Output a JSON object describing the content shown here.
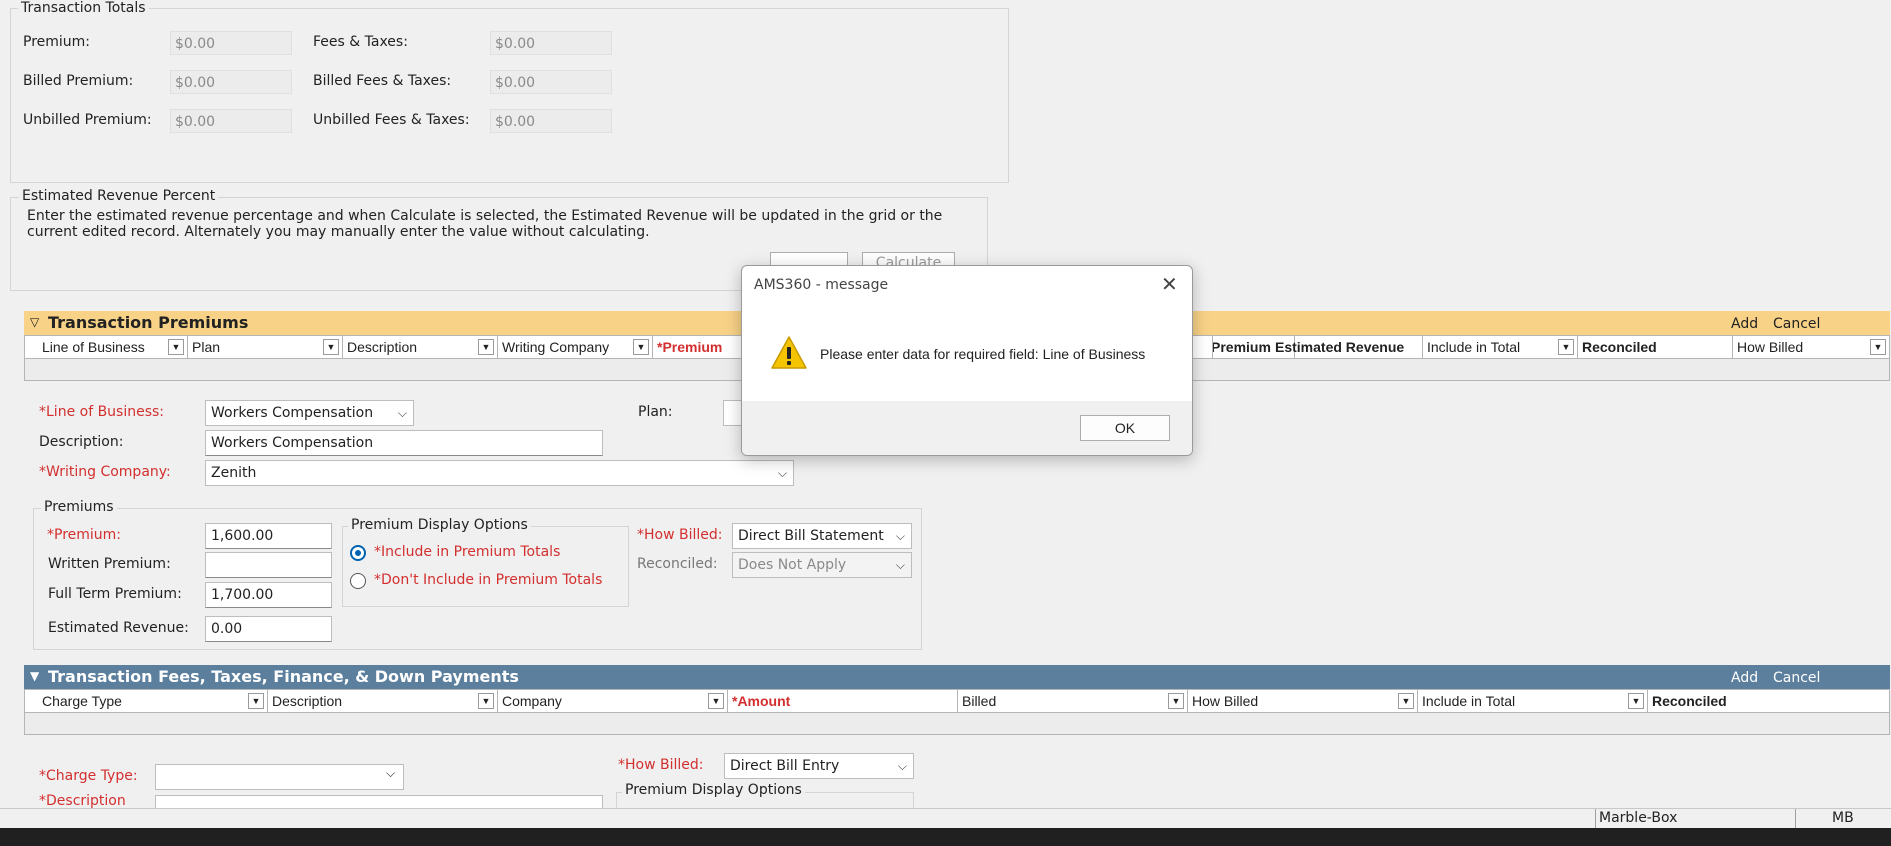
{
  "totals": {
    "legend": "Transaction Totals",
    "premium_label": "Premium:",
    "premium_value": "$0.00",
    "fees_label": "Fees & Taxes:",
    "fees_value": "$0.00",
    "billed_premium_label": "Billed Premium:",
    "billed_premium_value": "$0.00",
    "billed_fees_label": "Billed Fees & Taxes:",
    "billed_fees_value": "$0.00",
    "unbilled_premium_label": "Unbilled Premium:",
    "unbilled_premium_value": "$0.00",
    "unbilled_fees_label": "Unbilled Fees & Taxes:",
    "unbilled_fees_value": "$0.00"
  },
  "revenue": {
    "legend": "Estimated Revenue Percent",
    "description_line1": "Enter the estimated revenue percentage and when Calculate is selected, the Estimated Revenue will be updated in the grid or the",
    "description_line2": "current edited record. Alternately you may manually enter the value without calculating.",
    "calculate_label": "Calculate"
  },
  "premiums_section": {
    "title": "Transaction Premiums",
    "add_label": "Add",
    "cancel_label": "Cancel",
    "columns": [
      "Line of Business",
      "Plan",
      "Description",
      "Writing Company",
      "*Premium",
      "Premium",
      "Estimated Revenue",
      "Include in Total",
      "Reconciled",
      "How Billed"
    ]
  },
  "premium_form": {
    "line_of_business_label": "*Line of Business:",
    "line_of_business_value": "Workers Compensation",
    "plan_label": "Plan:",
    "description_label": "Description:",
    "description_value": "Workers Compensation",
    "writing_company_label": "*Writing Company:",
    "writing_company_value": "Zenith",
    "premiums_legend": "Premiums",
    "premium_label": "*Premium:",
    "premium_value": "1,600.00",
    "written_premium_label": "Written Premium:",
    "written_premium_value": "",
    "full_term_premium_label": "Full Term Premium:",
    "full_term_premium_value": "1,700.00",
    "estimated_revenue_label": "Estimated Revenue:",
    "estimated_revenue_value": "0.00",
    "display_options_legend": "Premium Display Options",
    "include_option": "*Include in Premium Totals",
    "dont_include_option": "*Don't Include in Premium Totals",
    "how_billed_label": "*How Billed:",
    "how_billed_value": "Direct Bill Statement",
    "reconciled_label": "Reconciled:",
    "reconciled_value": "Does Not Apply"
  },
  "fees_section": {
    "title": "Transaction Fees, Taxes, Finance, & Down Payments",
    "add_label": "Add",
    "cancel_label": "Cancel",
    "columns": [
      "Charge Type",
      "Description",
      "Company",
      "*Amount",
      "Billed",
      "How Billed",
      "Include in Total",
      "Reconciled"
    ]
  },
  "fee_form": {
    "charge_type_label": "*Charge Type:",
    "charge_type_value": "",
    "description_label": "*Description",
    "how_billed_label": "*How Billed:",
    "how_billed_value": "Direct Bill Entry",
    "display_options_legend": "Premium Display Options"
  },
  "dialog": {
    "title": "AMS360 - message",
    "message": "Please enter data for required field: Line of Business",
    "ok_label": "OK"
  },
  "statusbar": {
    "user": "Marble-Box",
    "initials": "MB"
  },
  "colors": {
    "premiums_bar": "#f8d287",
    "fees_bar": "#5b7f9d",
    "required_red": "#d32f2f",
    "warning_yellow": "#f5c400"
  }
}
